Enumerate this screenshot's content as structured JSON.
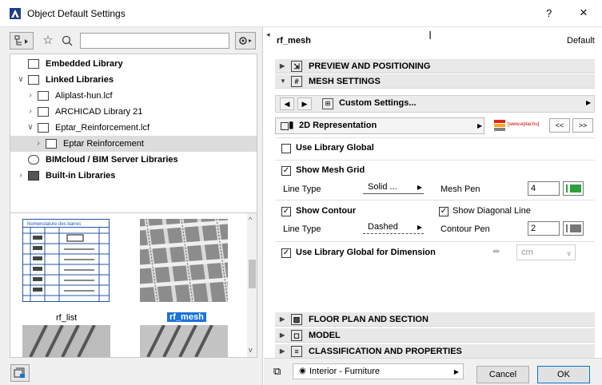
{
  "window": {
    "title": "Object Default Settings",
    "help": "?",
    "close": "×"
  },
  "left": {
    "search": {
      "value": "",
      "placeholder": ""
    },
    "tree": [
      {
        "label": "Embedded Library",
        "bold": true
      },
      {
        "label": "Linked Libraries",
        "bold": true
      },
      {
        "label": "Aliplast-hun.lcf",
        "bold": false
      },
      {
        "label": "ARCHICAD Library 21",
        "bold": false
      },
      {
        "label": "Eptar_Reinforcement.lcf",
        "bold": false
      },
      {
        "label": "Eptar Reinforcement",
        "bold": false
      },
      {
        "label": "BIMcloud / BIM Server Libraries",
        "bold": true
      },
      {
        "label": "Built-in Libraries",
        "bold": true
      }
    ],
    "thumbnails": [
      {
        "label": "rf_list",
        "selected": false
      },
      {
        "label": "rf_mesh",
        "selected": true
      }
    ],
    "nomenclature_title": "Nomenclature des barres"
  },
  "right": {
    "object_name": "rf_mesh",
    "default_label": "Default",
    "sections": {
      "preview": "PREVIEW AND POSITIONING",
      "mesh": "MESH SETTINGS",
      "floor": "FLOOR PLAN AND SECTION",
      "model": "MODEL",
      "classification": "CLASSIFICATION AND PROPERTIES"
    },
    "custom_settings": "Custom Settings...",
    "representation": "2D Representation",
    "logo_url": "[www.eptar.hu]",
    "page_prev": "<<",
    "page_next": ">>",
    "use_library_global": "Use Library Global",
    "show_mesh_grid": "Show Mesh Grid",
    "line_type_label": "Line Type",
    "mesh_line_type": "Solid ...",
    "mesh_pen_label": "Mesh Pen",
    "mesh_pen_value": "4",
    "show_contour": "Show Contour",
    "show_diagonal": "Show Diagonal Line",
    "contour_line_type": "Dashed",
    "contour_pen_label": "Contour Pen",
    "contour_pen_value": "2",
    "use_library_global_dimension": "Use Library Global for Dimension",
    "unit": "cm",
    "layer": "Interior - Furniture",
    "cancel": "Cancel",
    "ok": "OK"
  },
  "colors": {
    "mesh_pen": "#2e9e3e",
    "contour_pen": "#777777",
    "selection": "#1a73d9"
  }
}
